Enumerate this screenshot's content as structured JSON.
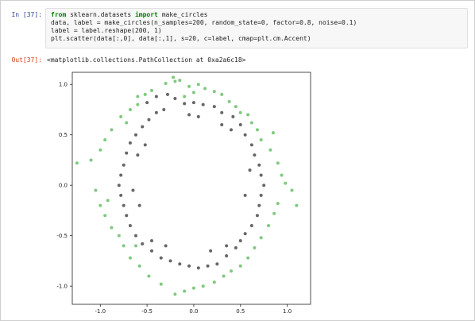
{
  "cell": {
    "input_prompt": "In [37]:",
    "code_lines": [
      {
        "kw1": "from",
        "mid": " sklearn.datasets ",
        "kw2": "import",
        "rest": " make_circles"
      },
      {
        "text": "data, label = make_circles(n_samples=200, random_state=0, factor=0.8, noise=0.1)"
      },
      {
        "text": "label = label.reshape(200, 1)"
      },
      {
        "text": "plt.scatter(data[:,0], data[:,1], s=20, c=label, cmap=plt.cm.Accent)"
      }
    ],
    "output_prompt": "Out[37]:",
    "output_text": "<matplotlib.collections.PathCollection at 0xa2a6c18>"
  },
  "colors": {
    "outer_class": "#7fc97f",
    "inner_class": "#666666",
    "input_prompt": "#303f9f",
    "output_prompt": "#d84315",
    "keyword": "#008000"
  },
  "chart_data": {
    "type": "scatter",
    "title": "",
    "xlabel": "",
    "ylabel": "",
    "xlim": [
      -1.3,
      1.25
    ],
    "ylim": [
      -1.18,
      1.12
    ],
    "x_ticks": [
      -1.0,
      -0.5,
      0.0,
      0.5,
      1.0
    ],
    "y_ticks": [
      1.0,
      0.5,
      0.0,
      -0.5,
      -1.0
    ],
    "x_tick_labels": [
      "-1.0",
      "-0.5",
      "0.0",
      "0.5",
      "1.0"
    ],
    "y_tick_labels": [
      "1.0",
      "0.5",
      "0.0",
      "-0.5",
      "-1.0"
    ],
    "grid": false,
    "series": [
      {
        "color": "#7fc97f",
        "points": [
          [
            -0.22,
            1.07
          ],
          [
            -0.2,
            1.03
          ],
          [
            -0.15,
            1.04
          ],
          [
            -0.3,
            1.01
          ],
          [
            -0.05,
            0.98
          ],
          [
            0.05,
            1.0
          ],
          [
            0.12,
            0.96
          ],
          [
            0.22,
            0.93
          ],
          [
            -0.45,
            0.94
          ],
          [
            -0.52,
            0.9
          ],
          [
            -0.6,
            0.88
          ],
          [
            0.3,
            0.9
          ],
          [
            0.38,
            0.83
          ],
          [
            0.45,
            0.78
          ],
          [
            0.5,
            0.72
          ],
          [
            0.58,
            0.7
          ],
          [
            0.62,
            0.62
          ],
          [
            0.68,
            0.55
          ],
          [
            0.72,
            0.45
          ],
          [
            0.85,
            0.52
          ],
          [
            0.82,
            0.35
          ],
          [
            0.9,
            0.22
          ],
          [
            0.94,
            0.1
          ],
          [
            0.98,
            0.02
          ],
          [
            1.05,
            -0.05
          ],
          [
            0.9,
            -0.18
          ],
          [
            0.86,
            -0.28
          ],
          [
            1.1,
            -0.2
          ],
          [
            0.8,
            -0.4
          ],
          [
            0.72,
            -0.52
          ],
          [
            0.65,
            -0.62
          ],
          [
            0.58,
            -0.72
          ],
          [
            0.5,
            -0.8
          ],
          [
            0.4,
            -0.85
          ],
          [
            0.32,
            -0.9
          ],
          [
            0.22,
            -0.96
          ],
          [
            0.1,
            -1.0
          ],
          [
            0.0,
            -1.02
          ],
          [
            -0.1,
            -1.05
          ],
          [
            -0.2,
            -1.08
          ],
          [
            -0.35,
            -0.98
          ],
          [
            -0.48,
            -0.9
          ],
          [
            -0.58,
            -0.8
          ],
          [
            -0.68,
            -0.72
          ],
          [
            -0.62,
            -0.6
          ],
          [
            -0.75,
            -0.6
          ],
          [
            -0.8,
            -0.5
          ],
          [
            -0.88,
            -0.42
          ],
          [
            -0.95,
            -0.3
          ],
          [
            -1.0,
            -0.2
          ],
          [
            -0.92,
            -0.15
          ],
          [
            -1.05,
            -0.05
          ],
          [
            -1.25,
            0.22
          ],
          [
            -1.1,
            0.25
          ],
          [
            -1.0,
            0.35
          ],
          [
            -0.95,
            0.45
          ],
          [
            -0.88,
            0.55
          ],
          [
            -0.78,
            0.68
          ],
          [
            -0.72,
            0.62
          ],
          [
            -0.68,
            0.75
          ],
          [
            -0.6,
            0.8
          ],
          [
            0.0,
            0.92
          ],
          [
            -0.1,
            0.88
          ]
        ]
      },
      {
        "color": "#666666",
        "points": [
          [
            -0.28,
            0.9
          ],
          [
            -0.4,
            0.88
          ],
          [
            -0.5,
            0.82
          ],
          [
            -0.2,
            0.86
          ],
          [
            -0.1,
            0.81
          ],
          [
            0.0,
            0.82
          ],
          [
            0.1,
            0.8
          ],
          [
            0.22,
            0.78
          ],
          [
            0.3,
            0.72
          ],
          [
            0.42,
            0.68
          ],
          [
            0.5,
            0.6
          ],
          [
            0.55,
            0.5
          ],
          [
            0.62,
            0.4
          ],
          [
            0.65,
            0.3
          ],
          [
            0.7,
            0.2
          ],
          [
            0.72,
            0.1
          ],
          [
            0.75,
            0.0
          ],
          [
            0.72,
            -0.1
          ],
          [
            0.7,
            -0.2
          ],
          [
            0.68,
            -0.3
          ],
          [
            0.62,
            -0.4
          ],
          [
            0.55,
            -0.48
          ],
          [
            0.5,
            -0.55
          ],
          [
            0.45,
            -0.62
          ],
          [
            0.35,
            -0.7
          ],
          [
            0.25,
            -0.78
          ],
          [
            0.15,
            -0.8
          ],
          [
            0.05,
            -0.82
          ],
          [
            -0.05,
            -0.8
          ],
          [
            -0.15,
            -0.78
          ],
          [
            -0.25,
            -0.75
          ],
          [
            -0.35,
            -0.72
          ],
          [
            -0.45,
            -0.65
          ],
          [
            -0.55,
            -0.58
          ],
          [
            -0.62,
            -0.5
          ],
          [
            -0.68,
            -0.4
          ],
          [
            -0.72,
            -0.3
          ],
          [
            -0.75,
            -0.2
          ],
          [
            -0.78,
            -0.1
          ],
          [
            -0.8,
            0.0
          ],
          [
            -0.78,
            0.1
          ],
          [
            -0.75,
            0.2
          ],
          [
            -0.72,
            0.32
          ],
          [
            -0.68,
            0.42
          ],
          [
            -0.62,
            0.5
          ],
          [
            -0.55,
            0.58
          ],
          [
            -0.48,
            0.65
          ],
          [
            -0.4,
            0.72
          ],
          [
            -0.32,
            0.75
          ],
          [
            -0.05,
            0.7
          ],
          [
            0.05,
            0.68
          ],
          [
            -0.6,
            0.3
          ],
          [
            -0.52,
            0.4
          ],
          [
            -0.58,
            -0.2
          ],
          [
            -0.65,
            -0.05
          ],
          [
            0.6,
            0.15
          ],
          [
            0.55,
            -0.1
          ],
          [
            0.4,
            0.55
          ],
          [
            0.3,
            0.6
          ],
          [
            -0.3,
            -0.6
          ],
          [
            -0.45,
            -0.55
          ],
          [
            0.35,
            -0.6
          ],
          [
            0.18,
            -0.65
          ]
        ]
      }
    ]
  }
}
